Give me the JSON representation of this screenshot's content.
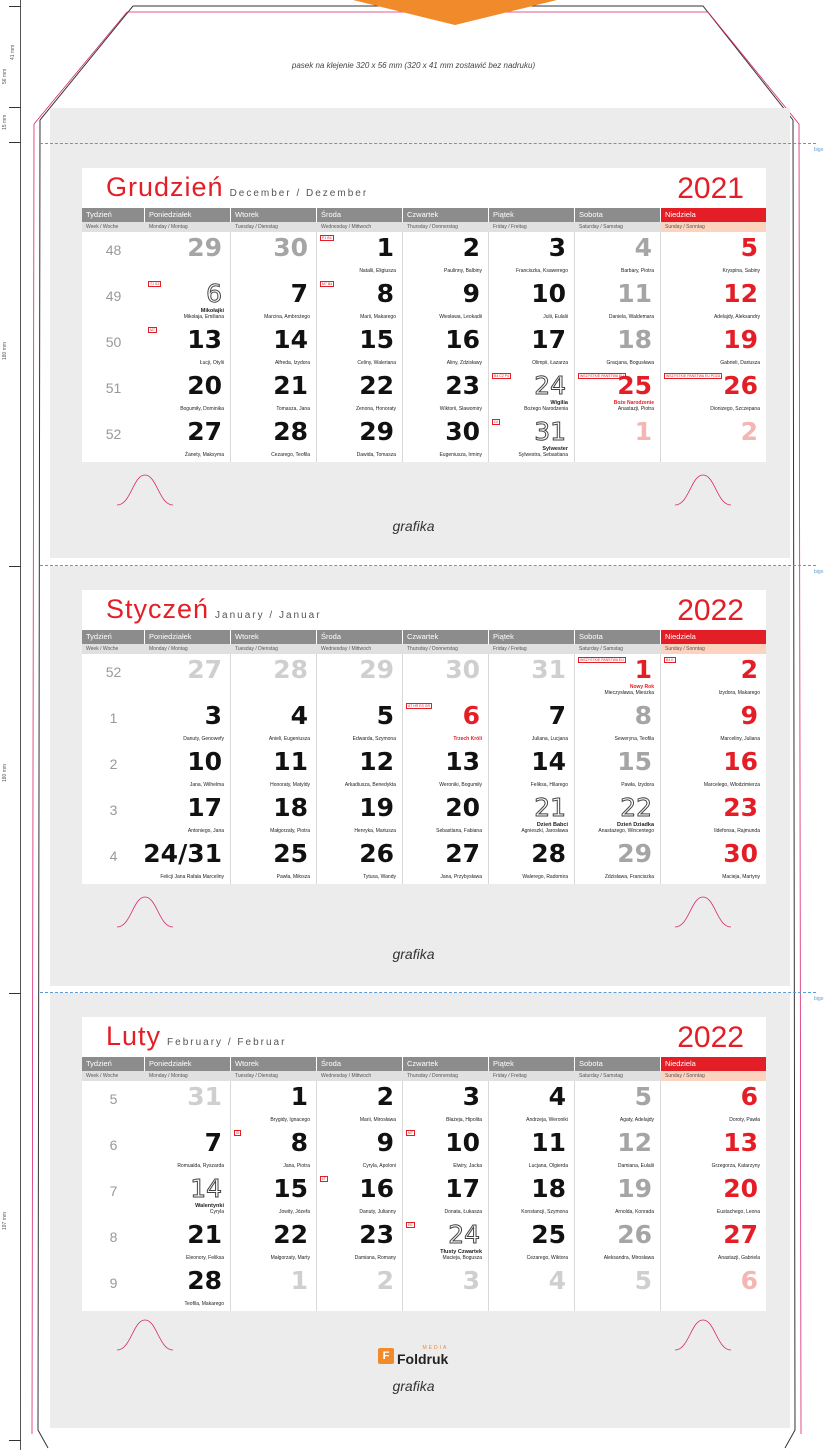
{
  "strip_note": "pasek na klejenie 320 x 56 mm (320 x 41 mm zostawić bez nadruku)",
  "fold_label": "bigo",
  "ruler_labels": [
    "56 mm",
    "41 mm",
    "15 mm",
    "180 mm",
    "180 mm",
    "197 mm"
  ],
  "grafika_label": "grafika",
  "logo": {
    "mark": "F",
    "text": "Foldruk",
    "sub": "MEDIA"
  },
  "weekdays": [
    "Tydzień",
    "Poniedziałek",
    "Wtorek",
    "Środa",
    "Czwartek",
    "Piątek",
    "Sobota",
    "Niedziela"
  ],
  "weekdays_sub": [
    "Week / Woche",
    "Monday / Montag",
    "Tuesday / Dienstag",
    "Wednesday / Mittwoch",
    "Thursday / Donnerstag",
    "Friday / Freitag",
    "Saturday / Samstag",
    "Sunday / Sonntag"
  ],
  "colors": {
    "accent": "#e41e26",
    "header_gray": "#8c8c8c",
    "orange": "#f08a2a"
  },
  "months": [
    {
      "name": "Grudzień",
      "sub": "December / Dezember",
      "year": "2021",
      "rows": [
        {
          "week": "48",
          "cells": [
            {
              "n": "29",
              "s": "gray",
              "names": ""
            },
            {
              "n": "30",
              "s": "gray",
              "names": ""
            },
            {
              "n": "1",
              "s": "",
              "names": "Natalii, Eligiusza",
              "tag": "P1 B4"
            },
            {
              "n": "2",
              "s": "",
              "names": "Paulinny, Balbiny"
            },
            {
              "n": "3",
              "s": "",
              "names": "Franciszka, Ksawerego"
            },
            {
              "n": "4",
              "s": "gray",
              "names": "Barbary, Piotra"
            },
            {
              "n": "5",
              "s": "red",
              "names": "Kryspina, Sabiny"
            }
          ]
        },
        {
          "week": "49",
          "cells": [
            {
              "n": "",
              "s": "",
              "names": ""
            },
            {
              "n": "6",
              "s": "outline",
              "names": "Mikołaja, Emiliana",
              "bold": "Mikołajki",
              "tag": "T1 S2"
            },
            {
              "n": "7",
              "s": "",
              "names": "Marcina, Ambrożego"
            },
            {
              "n": "8",
              "s": "",
              "names": "Marii, Makarego",
              "tag": "M7 B4"
            },
            {
              "n": "9",
              "s": "",
              "names": "Wiesława, Leokadii"
            },
            {
              "n": "10",
              "s": "",
              "names": "Julii, Eulalii"
            },
            {
              "n": "11",
              "s": "gray",
              "names": "Daniela, Waldemara"
            },
            {
              "n": "12",
              "s": "red",
              "names": "Adelajdy, Aleksandry"
            }
          ]
        },
        {
          "week": "50",
          "cells": [
            {
              "n": "13",
              "s": "",
              "names": "Łucji, Otylii",
              "tag": "M7"
            },
            {
              "n": "14",
              "s": "",
              "names": "Alfreda, Izydora"
            },
            {
              "n": "15",
              "s": "",
              "names": "Celiny, Waleriana"
            },
            {
              "n": "16",
              "s": "",
              "names": "Aliny, Zdzisławy"
            },
            {
              "n": "17",
              "s": "",
              "names": "Olimpii, Łazarza"
            },
            {
              "n": "18",
              "s": "gray",
              "names": "Gracjana, Bogusława"
            },
            {
              "n": "19",
              "s": "red",
              "names": "Gabrieli, Dariusza"
            }
          ]
        },
        {
          "week": "51",
          "cells": [
            {
              "n": "20",
              "s": "",
              "names": "Bogumiły, Dominika"
            },
            {
              "n": "21",
              "s": "",
              "names": "Tomasza, Jana"
            },
            {
              "n": "22",
              "s": "",
              "names": "Zenona, Honoraty"
            },
            {
              "n": "23",
              "s": "",
              "names": "Wiktorii, Sławomiry"
            },
            {
              "n": "24",
              "s": "outline",
              "names": "Bożego Narodzenia",
              "bold": "Wigilia",
              "tag": "B4 C2 P4"
            },
            {
              "n": "25",
              "s": "red",
              "names": "Anastazji, Piotra",
              "red": "Boże Narodzenie",
              "tag": "WSZYSTKIE PAŃSTWA EU"
            },
            {
              "n": "26",
              "s": "red",
              "names": "Dionizego, Szczepana",
              "tag": "WSZYSTKIE PAŃSTWA EU POZA"
            }
          ]
        },
        {
          "week": "52",
          "cells": [
            {
              "n": "27",
              "s": "",
              "names": "Żanety, Maksyma"
            },
            {
              "n": "28",
              "s": "",
              "names": "Cezarego, Teofila"
            },
            {
              "n": "29",
              "s": "",
              "names": "Dawida, Tomasza"
            },
            {
              "n": "30",
              "s": "",
              "names": "Eugeniusza, Irminy"
            },
            {
              "n": "31",
              "s": "outline",
              "names": "Sylwestra, Sebastiana",
              "bold": "Sylwester",
              "tag": "LV"
            },
            {
              "n": "1",
              "s": "pink",
              "names": ""
            },
            {
              "n": "2",
              "s": "pink",
              "names": ""
            }
          ]
        }
      ]
    },
    {
      "name": "Styczeń",
      "sub": "January / Januar",
      "year": "2022",
      "rows": [
        {
          "week": "52",
          "cells": [
            {
              "n": "27",
              "s": "light",
              "names": ""
            },
            {
              "n": "28",
              "s": "light",
              "names": ""
            },
            {
              "n": "29",
              "s": "light",
              "names": ""
            },
            {
              "n": "30",
              "s": "light",
              "names": ""
            },
            {
              "n": "31",
              "s": "light",
              "names": ""
            },
            {
              "n": "1",
              "s": "red",
              "names": "Mieczysława, Mieszka",
              "red": "Nowy Rok",
              "tag": "WSZYSTKIE PAŃSTWA EU"
            },
            {
              "n": "2",
              "s": "red",
              "names": "Izydora, Makarego",
              "tag": "B4 K"
            }
          ]
        },
        {
          "week": "1",
          "cells": [
            {
              "n": "3",
              "s": "",
              "names": "Danuty, Genowefy"
            },
            {
              "n": "4",
              "s": "",
              "names": "Anieli, Eugeniusza"
            },
            {
              "n": "5",
              "s": "",
              "names": "Edwarda, Szymona"
            },
            {
              "n": "6",
              "s": "red",
              "names": "",
              "red": "Trzech Króli",
              "tag": "AT HR ES GR"
            },
            {
              "n": "7",
              "s": "",
              "names": "Juliana, Lucjana"
            },
            {
              "n": "8",
              "s": "gray",
              "names": "Seweryna, Teofila"
            },
            {
              "n": "9",
              "s": "red",
              "names": "Marceliny, Juliana"
            }
          ]
        },
        {
          "week": "2",
          "cells": [
            {
              "n": "10",
              "s": "",
              "names": "Jana, Wilhelma"
            },
            {
              "n": "11",
              "s": "",
              "names": "Honoraty, Matyldy"
            },
            {
              "n": "12",
              "s": "",
              "names": "Arkadiusza, Benedykta"
            },
            {
              "n": "13",
              "s": "",
              "names": "Weroniki, Bogumiły"
            },
            {
              "n": "14",
              "s": "",
              "names": "Feliksa, Hilarego"
            },
            {
              "n": "15",
              "s": "gray",
              "names": "Pawła, Izydora"
            },
            {
              "n": "16",
              "s": "red",
              "names": "Marcelego, Włodzimierza"
            }
          ]
        },
        {
          "week": "3",
          "cells": [
            {
              "n": "17",
              "s": "",
              "names": "Antoniego, Jana"
            },
            {
              "n": "18",
              "s": "",
              "names": "Małgorzaty, Piotra"
            },
            {
              "n": "19",
              "s": "",
              "names": "Henryka, Mariusza"
            },
            {
              "n": "20",
              "s": "",
              "names": "Sebastiana, Fabiana"
            },
            {
              "n": "21",
              "s": "outline",
              "names": "Agnieszki, Jarosława",
              "bold": "Dzień Babci"
            },
            {
              "n": "22",
              "s": "outline",
              "names": "Anastazego, Wincentego",
              "bold": "Dzień Dziadka"
            },
            {
              "n": "23",
              "s": "red",
              "names": "Ildefonsa, Rajmunda"
            }
          ]
        },
        {
          "week": "4",
          "cells": [
            {
              "n": "24/31",
              "s": "",
              "names": "Felicji Jana Rafała Marceliny"
            },
            {
              "n": "25",
              "s": "",
              "names": "Pawła, Miłosza"
            },
            {
              "n": "26",
              "s": "",
              "names": "Tytusa, Wandy"
            },
            {
              "n": "27",
              "s": "",
              "names": "Jana, Przybysława"
            },
            {
              "n": "28",
              "s": "",
              "names": "Walerego, Radomira"
            },
            {
              "n": "29",
              "s": "gray",
              "names": "Zdzisława, Franciszka"
            },
            {
              "n": "30",
              "s": "red",
              "names": "Macieja, Martyny"
            }
          ]
        }
      ]
    },
    {
      "name": "Luty",
      "sub": "February / Februar",
      "year": "2022",
      "rows": [
        {
          "week": "5",
          "cells": [
            {
              "n": "31",
              "s": "light",
              "names": ""
            },
            {
              "n": "1",
              "s": "",
              "names": "Brygidy, Ignacego"
            },
            {
              "n": "2",
              "s": "",
              "names": "Marii, Mirosława"
            },
            {
              "n": "3",
              "s": "",
              "names": "Błażeja, Hipolita"
            },
            {
              "n": "4",
              "s": "",
              "names": "Andrzeja, Weroniki"
            },
            {
              "n": "5",
              "s": "gray",
              "names": "Agaty, Adelajdy"
            },
            {
              "n": "6",
              "s": "red",
              "names": "Doroty, Pawła"
            }
          ]
        },
        {
          "week": "6",
          "cells": [
            {
              "n": "7",
              "s": "",
              "names": "Romualda, Ryszarda"
            },
            {
              "n": "8",
              "s": "",
              "names": "Jana, Piotra",
              "tag": "SI"
            },
            {
              "n": "9",
              "s": "",
              "names": "Cyryla, Apoloni"
            },
            {
              "n": "10",
              "s": "",
              "names": "Elwiry, Jacka",
              "tag": "MT"
            },
            {
              "n": "11",
              "s": "",
              "names": "Lucjana, Olgierda"
            },
            {
              "n": "12",
              "s": "gray",
              "names": "Damiana, Eulalii"
            },
            {
              "n": "13",
              "s": "red",
              "names": "Grzegorza, Katarzyny"
            }
          ]
        },
        {
          "week": "7",
          "cells": [
            {
              "n": "14",
              "s": "outline",
              "names": "Cyryla",
              "bold": "Walentynki"
            },
            {
              "n": "15",
              "s": "",
              "names": "Jowity, Józefa"
            },
            {
              "n": "16",
              "s": "",
              "names": "Danuty, Julianny",
              "tag": "LT"
            },
            {
              "n": "17",
              "s": "",
              "names": "Donata, Łukasza"
            },
            {
              "n": "18",
              "s": "",
              "names": "Konstancji, Szymona"
            },
            {
              "n": "19",
              "s": "gray",
              "names": "Arnolda, Konrada"
            },
            {
              "n": "20",
              "s": "red",
              "names": "Eustachego, Leona"
            }
          ]
        },
        {
          "week": "8",
          "cells": [
            {
              "n": "21",
              "s": "",
              "names": "Eleonory, Feliksa"
            },
            {
              "n": "22",
              "s": "",
              "names": "Małgorzaty, Marty"
            },
            {
              "n": "23",
              "s": "",
              "names": "Damiana, Romany"
            },
            {
              "n": "24",
              "s": "outline",
              "names": "Macieja, Bogusza",
              "bold": "Tłusty Czwartek",
              "tag": "EE"
            },
            {
              "n": "25",
              "s": "",
              "names": "Cezarego, Wiktora"
            },
            {
              "n": "26",
              "s": "gray",
              "names": "Aleksandra, Mirosława"
            },
            {
              "n": "27",
              "s": "red",
              "names": "Anastazji, Gabriela"
            }
          ]
        },
        {
          "week": "9",
          "cells": [
            {
              "n": "28",
              "s": "",
              "names": "Teofila, Makarego"
            },
            {
              "n": "1",
              "s": "light",
              "names": ""
            },
            {
              "n": "2",
              "s": "light",
              "names": ""
            },
            {
              "n": "3",
              "s": "light",
              "names": ""
            },
            {
              "n": "4",
              "s": "light",
              "names": ""
            },
            {
              "n": "5",
              "s": "light",
              "names": ""
            },
            {
              "n": "6",
              "s": "pink",
              "names": ""
            }
          ]
        }
      ]
    }
  ]
}
